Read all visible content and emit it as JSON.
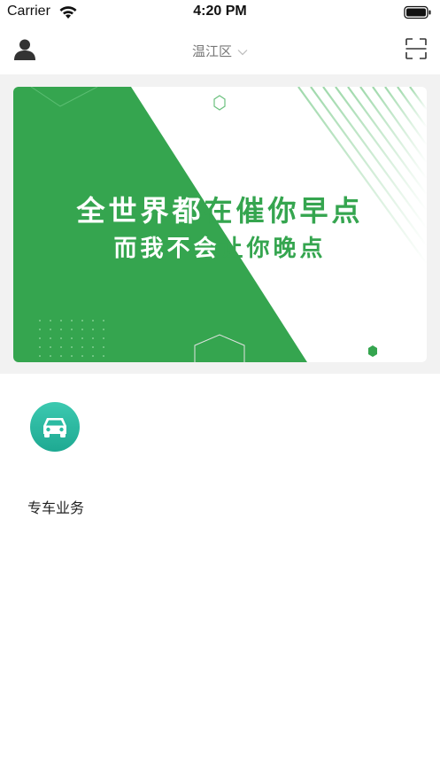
{
  "status_bar": {
    "carrier": "Carrier",
    "time": "4:20 PM",
    "wifi_icon": "wifi-icon",
    "battery_icon": "battery-icon"
  },
  "nav": {
    "user_icon": "user-icon",
    "location": "温江区",
    "location_icon": "chevron-down-icon",
    "scan_icon": "scan-icon"
  },
  "banner": {
    "line1_white": "全世界都",
    "line1_green": "在催你早点",
    "line2_white": "而我不会",
    "line2_green": "让你晚点",
    "colors": {
      "green": "#35a54f",
      "light_stripe": "#bfe5c6"
    }
  },
  "services": [
    {
      "label": "专车业务",
      "icon": "car-icon",
      "color": "#2bbba2"
    }
  ]
}
